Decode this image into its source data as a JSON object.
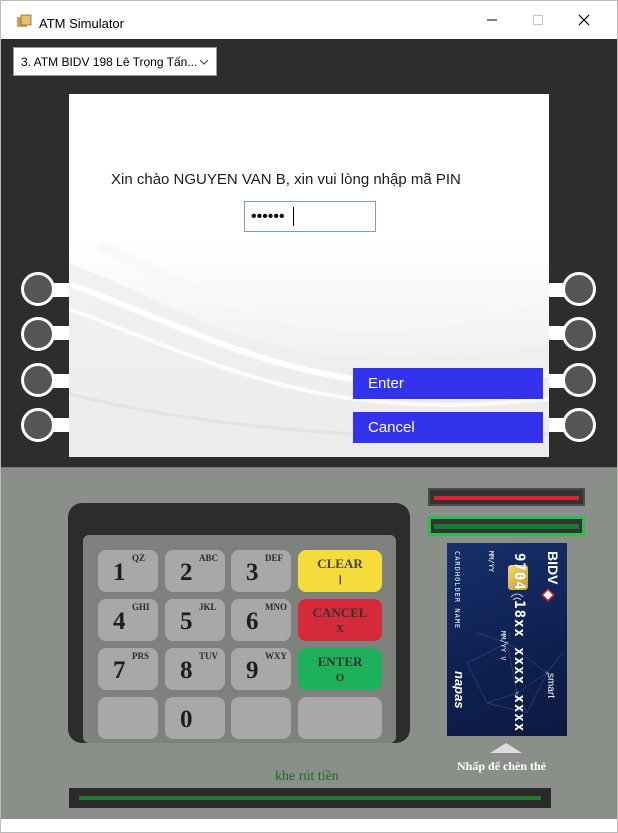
{
  "window": {
    "title": "ATM Simulator",
    "icon": "atm-app-icon",
    "controls": {
      "minimize": "—",
      "maximize": "☐",
      "close": "✕"
    }
  },
  "atm_selector": {
    "selected": "3. ATM BIDV 198 Lê Trọng Tấn...",
    "arrow_icon": "chevron-down-icon"
  },
  "screen": {
    "greeting": "Xin chào NGUYEN VAN B, xin vui lòng nhập mã PIN",
    "pin_masked": "••••••",
    "buttons": {
      "enter": "Enter",
      "cancel": "Cancel"
    },
    "button_color": "#3333ee"
  },
  "keypad": {
    "keys": [
      {
        "num": "1",
        "letters": "QZ"
      },
      {
        "num": "2",
        "letters": "ABC"
      },
      {
        "num": "3",
        "letters": "DEF"
      },
      {
        "num": "4",
        "letters": "GHI"
      },
      {
        "num": "5",
        "letters": "JKL"
      },
      {
        "num": "6",
        "letters": "MNO"
      },
      {
        "num": "7",
        "letters": "PRS"
      },
      {
        "num": "8",
        "letters": "TUV"
      },
      {
        "num": "9",
        "letters": "WXY"
      },
      {
        "num": "0",
        "letters": ""
      }
    ],
    "function_keys": {
      "clear": {
        "label": "CLEAR",
        "symbol": "]",
        "color": "#f5dc3a"
      },
      "cancel": {
        "label": "CANCEL",
        "symbol": "X",
        "color": "#d42a3a"
      },
      "enter": {
        "label": "ENTER",
        "symbol": "O",
        "color": "#1db15a"
      }
    }
  },
  "card": {
    "bank": "BIDV",
    "number": "9704 18xx xxxx xxxx",
    "holder": "CARDHOLDER NAME",
    "expiry_1": "MM/YY",
    "expiry_2": "MM/YY   V",
    "network": "napas",
    "smart": "smart",
    "insert_label": "Nhấp để chèn thẻ"
  },
  "cash": {
    "label": "khe rút tiền"
  }
}
